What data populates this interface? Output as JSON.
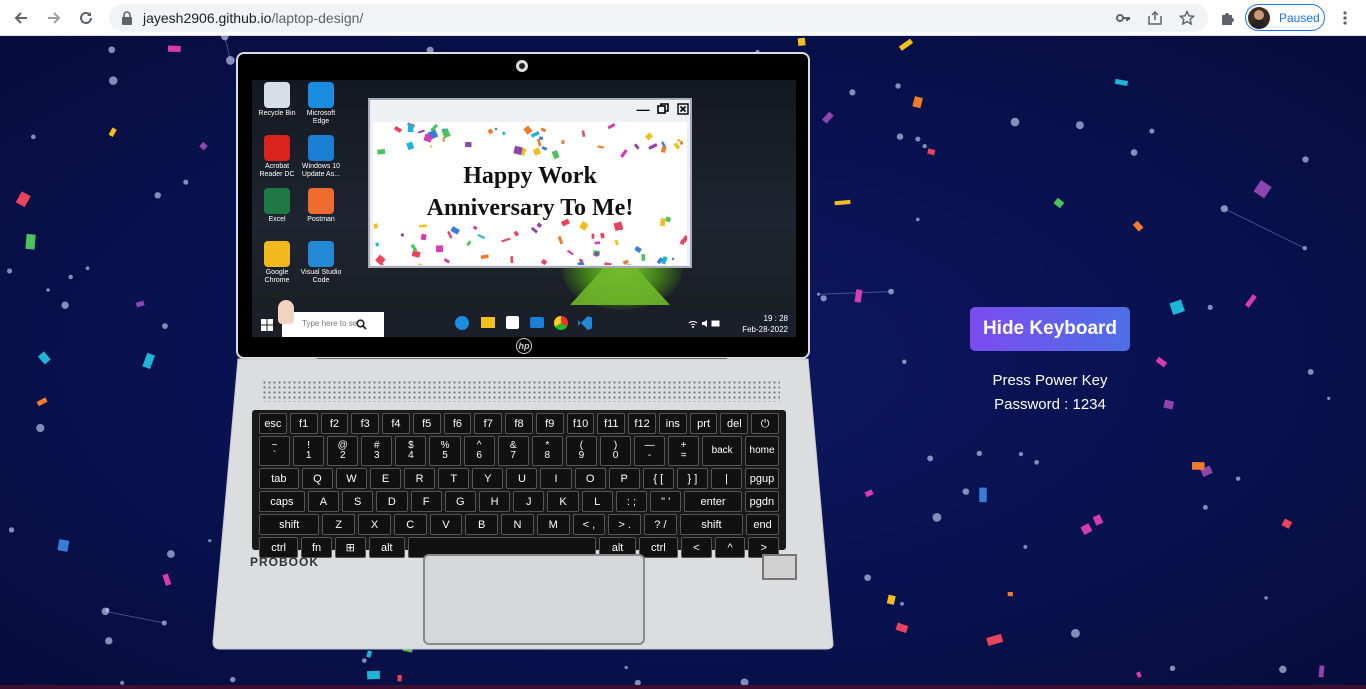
{
  "browser": {
    "url_host": "jayesh2906.github.io",
    "url_path": "/laptop-design/",
    "profile_status": "Paused"
  },
  "desktop": {
    "icons": [
      {
        "label": "Recycle Bin",
        "icon": "recycle-bin-icon",
        "color": "#d8dde6"
      },
      {
        "label": "Microsoft Edge",
        "icon": "edge-icon",
        "color": "#1c8ce0"
      },
      {
        "label": "Acrobat Reader DC",
        "icon": "acrobat-icon",
        "color": "#d8241c"
      },
      {
        "label": "Windows 10 Update As...",
        "icon": "windows-update-icon",
        "color": "#1c7fd6"
      },
      {
        "label": "Excel",
        "icon": "excel-icon",
        "color": "#1d7a43"
      },
      {
        "label": "Postman",
        "icon": "postman-icon",
        "color": "#ef6b2f"
      },
      {
        "label": "Google Chrome",
        "icon": "chrome-icon",
        "color": "#f2b81c"
      },
      {
        "label": "Visual Studio Code",
        "icon": "vscode-icon",
        "color": "#2388d6"
      }
    ],
    "window_title_lines": [
      "Happy Work",
      "Anniversary To Me!"
    ],
    "taskbar_search_placeholder": "Type here to se",
    "clock_time": "19 : 28",
    "clock_date": "Feb-28-2022"
  },
  "laptop": {
    "brand_mark": "hp",
    "model": "PROBOOK",
    "keyboard_rows": [
      [
        "esc",
        "f1",
        "f2",
        "f3",
        "f4",
        "f5",
        "f6",
        "f7",
        "f8",
        "f9",
        "f10",
        "f11",
        "f12",
        "ins",
        "prt",
        "del",
        "⏻"
      ],
      [
        "~\n`",
        "!\n1",
        "@\n2",
        "#\n3",
        "$\n4",
        "%\n5",
        "^\n6",
        "&\n7",
        "*\n8",
        "(\n9",
        ")\n0",
        "—\n-",
        "+\n=",
        "back",
        "home"
      ],
      [
        "tab",
        "Q",
        "W",
        "E",
        "R",
        "T",
        "Y",
        "U",
        "I",
        "O",
        "P",
        "{ [",
        "} ]",
        "|",
        "pgup"
      ],
      [
        "caps",
        "A",
        "S",
        "D",
        "F",
        "G",
        "H",
        "J",
        "K",
        "L",
        ": ;",
        "\" '",
        "enter",
        "pgdn"
      ],
      [
        "shift",
        "Z",
        "X",
        "C",
        "V",
        "B",
        "N",
        "M",
        "< ,",
        "> .",
        "? /",
        "shift",
        "end"
      ],
      [
        "ctrl",
        "fn",
        "⊞",
        "alt",
        "",
        "alt",
        "ctrl",
        "<",
        "^",
        ">"
      ]
    ]
  },
  "panel": {
    "hide_keyboard_label": "Hide Keyboard",
    "instruction": "Press Power Key",
    "password_line": "Password : 1234"
  }
}
